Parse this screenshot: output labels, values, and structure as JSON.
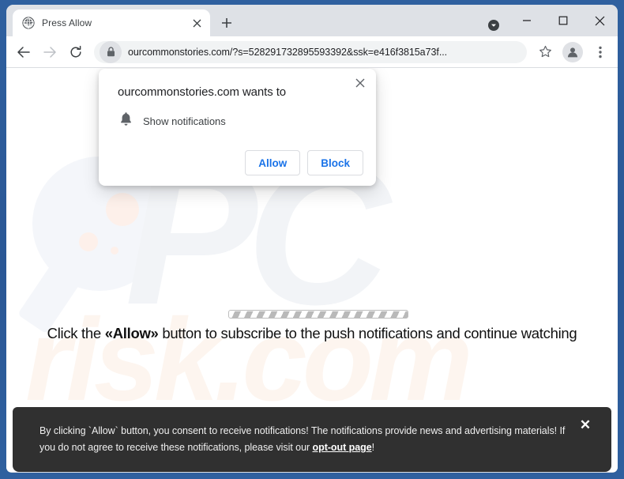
{
  "browser": {
    "tab": {
      "title": "Press Allow",
      "favicon": "globe-icon",
      "close": "close-icon"
    },
    "new_tab": "+",
    "window_controls": {
      "tab_search": "tab-search-icon",
      "minimize": "minimize-icon",
      "maximize": "maximize-icon",
      "close": "close-icon"
    },
    "toolbar": {
      "back": "back-arrow-icon",
      "forward": "forward-arrow-icon",
      "reload": "reload-icon",
      "lock": "lock-icon",
      "url": "ourcommonstories.com/?s=528291732895593392&ssk=e416f3815a73f...",
      "bookmark": "star-icon",
      "profile": "profile-avatar-icon",
      "menu": "three-dot-menu-icon"
    }
  },
  "dialog": {
    "title": "ourcommonstories.com wants to",
    "permission_icon": "bell-icon",
    "permission_label": "Show notifications",
    "allow_label": "Allow",
    "block_label": "Block",
    "close": "close-icon"
  },
  "page": {
    "message_prefix": "Click the ",
    "message_emphasis": "«Allow»",
    "message_suffix": " button to subscribe to the push notifications and continue watching",
    "watermark_pc": "PC",
    "watermark_risk": "risk.com"
  },
  "consent_bar": {
    "text_before_link": "By clicking `Allow` button, you consent to receive notifications! The notifications provide news and advertising materials! If you do not agree to receive these notifications, please visit our ",
    "link_label": "opt-out page",
    "text_after_link": "!",
    "close": "close-icon"
  },
  "colors": {
    "frame_blue": "#2b5797",
    "chrome_grey": "#dee1e6",
    "accent_blue": "#1a73e8",
    "consent_dark": "#303030"
  }
}
